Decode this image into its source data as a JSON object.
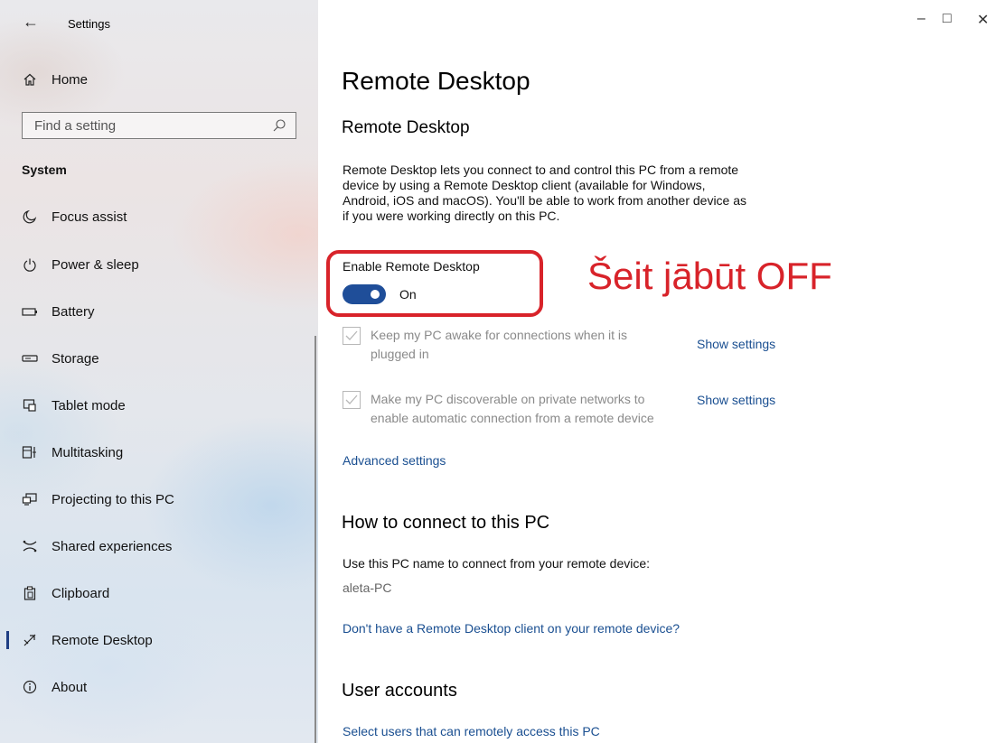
{
  "window": {
    "title": "Settings",
    "controls": {
      "minimize": "–",
      "maximize": "□",
      "close": "✕"
    }
  },
  "sidebar": {
    "home_label": "Home",
    "search_placeholder": "Find a setting",
    "section_label": "System",
    "items": [
      {
        "label": "Focus assist",
        "icon": "moon-icon"
      },
      {
        "label": "Power & sleep",
        "icon": "power-icon"
      },
      {
        "label": "Battery",
        "icon": "battery-icon"
      },
      {
        "label": "Storage",
        "icon": "storage-icon"
      },
      {
        "label": "Tablet mode",
        "icon": "tablet-mode-icon"
      },
      {
        "label": "Multitasking",
        "icon": "multitasking-icon"
      },
      {
        "label": "Projecting to this PC",
        "icon": "projecting-icon"
      },
      {
        "label": "Shared experiences",
        "icon": "shared-experiences-icon"
      },
      {
        "label": "Clipboard",
        "icon": "clipboard-icon"
      },
      {
        "label": "Remote Desktop",
        "icon": "remote-desktop-icon",
        "selected": true
      },
      {
        "label": "About",
        "icon": "info-icon"
      }
    ]
  },
  "main": {
    "title": "Remote Desktop",
    "section_title": "Remote Desktop",
    "description": [
      "Remote Desktop lets you connect to and control this PC from a remote",
      "device by using a Remote Desktop client (available for Windows,",
      "Android, iOS and macOS). You'll be able to work from another device as",
      "if you were working directly on this PC."
    ],
    "enable_label": "Enable Remote Desktop",
    "toggle_state": "On",
    "option1": [
      "Keep my PC awake for connections when it is",
      "plugged in"
    ],
    "option2": [
      "Make my PC discoverable on private networks to",
      "enable automatic connection from a remote device"
    ],
    "show_settings_1": "Show settings",
    "show_settings_2": "Show settings",
    "advanced_settings": "Advanced settings",
    "how_to_connect_title": "How to connect to this PC",
    "how_to_connect_text": "Use this PC name to connect from your remote device:",
    "pc_name": "aleta-PC",
    "no_client_link": "Don't have a Remote Desktop client on your remote device?",
    "user_accounts_title": "User accounts",
    "select_users_link": "Select users that can remotely access this PC"
  },
  "annotation": {
    "text": "Šeit jābūt OFF",
    "color": "#d8232a"
  },
  "colors": {
    "accent": "#1f4e99",
    "link": "#1a4f91",
    "annotation": "#d8232a"
  }
}
